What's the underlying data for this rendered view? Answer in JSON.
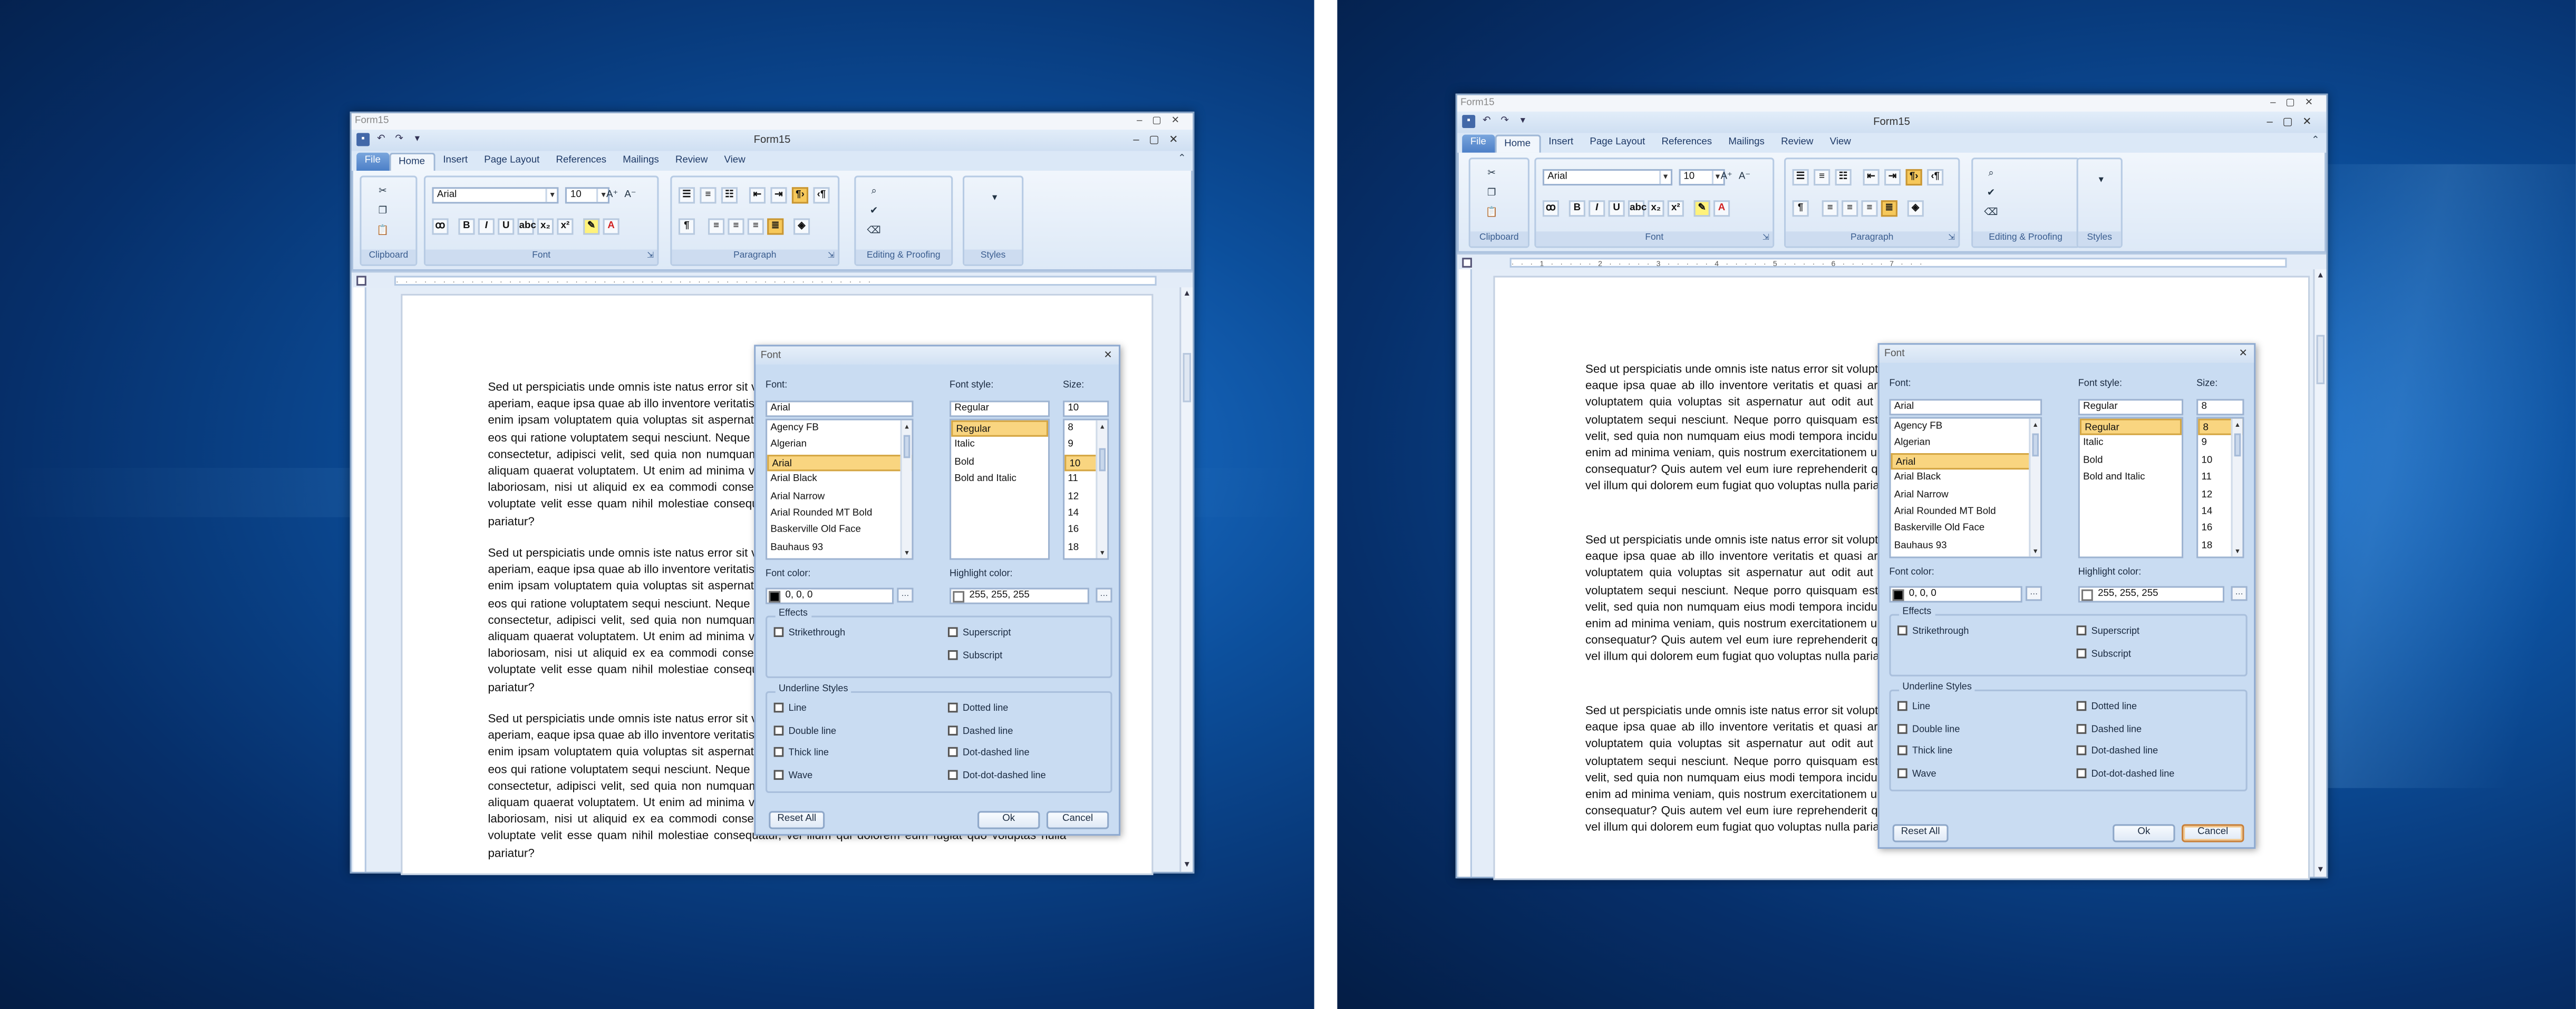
{
  "window": {
    "outer_title": "Form15",
    "title": "Form15",
    "tabs": [
      "File",
      "Home",
      "Insert",
      "Page Layout",
      "References",
      "Mailings",
      "Review",
      "View"
    ],
    "active_tab": "Home"
  },
  "ribbon": {
    "groups": {
      "clipboard": "Clipboard",
      "font": "Font",
      "paragraph": "Paragraph",
      "editing": "Editing & Proofing",
      "styles": "Styles"
    },
    "font_name": "Arial",
    "font_size": "10"
  },
  "document": {
    "paragraphs": [
      "Sed ut perspiciatis unde omnis iste natus error sit voluptatem accusantium doloremque laudantium, totam rem aperiam, eaque ipsa quae ab illo inventore veritatis et quasi architecto beatae vitae dicta sunt explicabo. Nemo enim ipsam voluptatem quia voluptas sit aspernatur aut odit aut fugit, sed quia consequuntur magni dolores eos qui ratione voluptatem sequi nesciunt. Neque porro quisquam est, qui dolorem ipsum quia dolor sit amet, consectetur, adipisci velit, sed quia non numquam eius modi tempora incidunt ut labore et dolore magnam aliquam quaerat voluptatem. Ut enim ad minima veniam, quis nostrum exercitationem ullam corporis suscipit laboriosam, nisi ut aliquid ex ea commodi consequatur? Quis autem vel eum iure reprehenderit qui in ea voluptate velit esse quam nihil molestiae consequatur, vel illum qui dolorem eum fugiat quo voluptas nulla pariatur?"
    ]
  },
  "dialog": {
    "title": "Font",
    "font_label": "Font:",
    "style_label": "Font style:",
    "size_label": "Size:",
    "fonts": [
      "Agency FB",
      "Algerian",
      "Arial",
      "Arial Black",
      "Arial Narrow",
      "Arial Rounded MT Bold",
      "Baskerville Old Face",
      "Bauhaus 93"
    ],
    "styles": [
      "Regular",
      "Italic",
      "Bold",
      "Bold and Italic"
    ],
    "sizes": [
      "8",
      "9",
      "10",
      "11",
      "12",
      "14",
      "16",
      "18"
    ],
    "font_color_label": "Font color:",
    "font_color_value": "0, 0, 0",
    "highlight_label": "Highlight color:",
    "highlight_value": "255, 255, 255",
    "effects_label": "Effects",
    "effects": [
      "Strikethrough",
      "Superscript",
      "Subscript"
    ],
    "underline_label": "Underline Styles",
    "underlines_left": [
      "Line",
      "Double line",
      "Thick line",
      "Wave"
    ],
    "underlines_right": [
      "Dotted line",
      "Dashed line",
      "Dot-dashed line",
      "Dot-dot-dashed line"
    ],
    "reset": "Reset All",
    "ok": "Ok",
    "cancel": "Cancel"
  },
  "left": {
    "font": "Arial",
    "style": "Regular",
    "size": "10"
  },
  "right": {
    "font": "Arial",
    "style": "Regular",
    "size": "8"
  },
  "colors": {
    "accent": "#f9d580",
    "ribbon": "#dbe8f7",
    "desktop": "#0c4f9c"
  }
}
